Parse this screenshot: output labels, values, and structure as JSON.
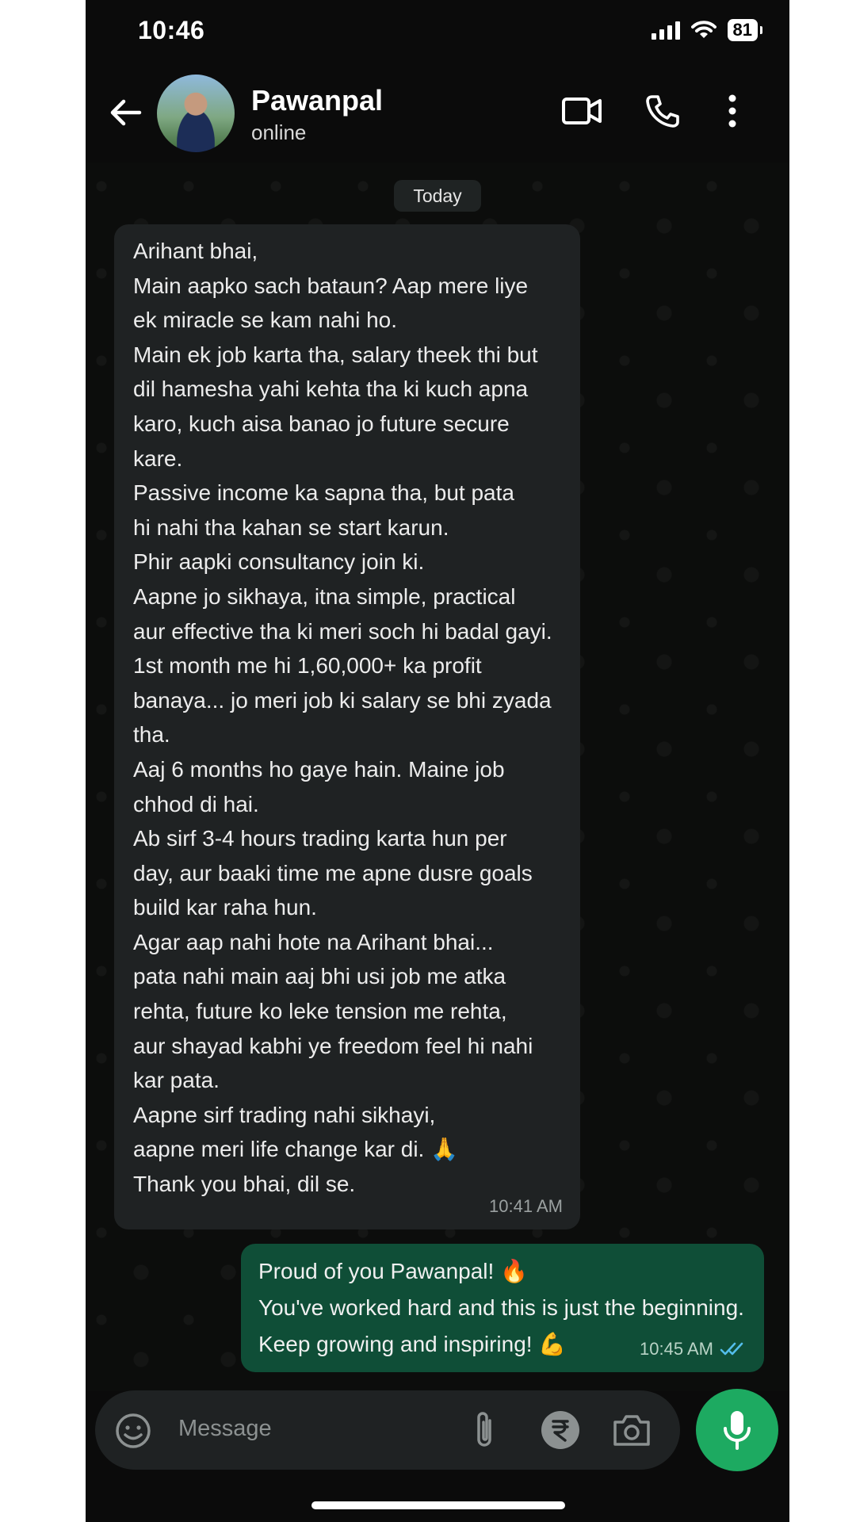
{
  "status_bar": {
    "time": "10:46",
    "battery": "81"
  },
  "header": {
    "contact_name": "Pawanpal",
    "contact_status": "online"
  },
  "chat": {
    "date_chip": "Today",
    "messages": [
      {
        "direction": "incoming",
        "text": "Arihant bhai,\nMain aapko sach bataun? Aap mere liye\nek miracle se kam nahi ho.\nMain ek job karta tha, salary theek thi but\ndil hamesha yahi kehta tha ki kuch apna\nkaro, kuch aisa banao jo future secure\nkare.\nPassive income ka sapna tha, but pata\nhi nahi tha kahan se start karun.\nPhir aapki consultancy join ki.\nAapne jo sikhaya, itna simple, practical\naur effective tha ki meri soch hi badal gayi.\n1st month me hi 1,60,000+ ka profit\nbanaya... jo meri job ki salary se bhi zyada\ntha.\nAaj 6 months ho gaye hain. Maine job\nchhod di hai.\nAb sirf 3-4 hours trading karta hun per\nday, aur baaki time me apne dusre goals\nbuild kar raha hun.\nAgar aap nahi hote na Arihant bhai...\npata nahi main aaj bhi usi job me atka\nrehta, future ko leke tension me rehta,\naur shayad kabhi ye freedom feel hi nahi\nkar pata.\nAapne sirf trading nahi sikhayi,\naapne meri life change kar di. 🙏\nThank you bhai, dil se.",
        "time": "10:41 AM"
      },
      {
        "direction": "outgoing",
        "text": "Proud of you Pawanpal! 🔥\nYou've worked hard and this is just the beginning.\nKeep growing and inspiring! 💪",
        "time": "10:45 AM",
        "read_status": "read"
      }
    ]
  },
  "composer": {
    "placeholder": "Message"
  },
  "colors": {
    "accent": "#1daa61",
    "outgoing_bubble": "#0f4e37",
    "incoming_bubble": "#1f2223",
    "read_ticks": "#53bdeb"
  }
}
